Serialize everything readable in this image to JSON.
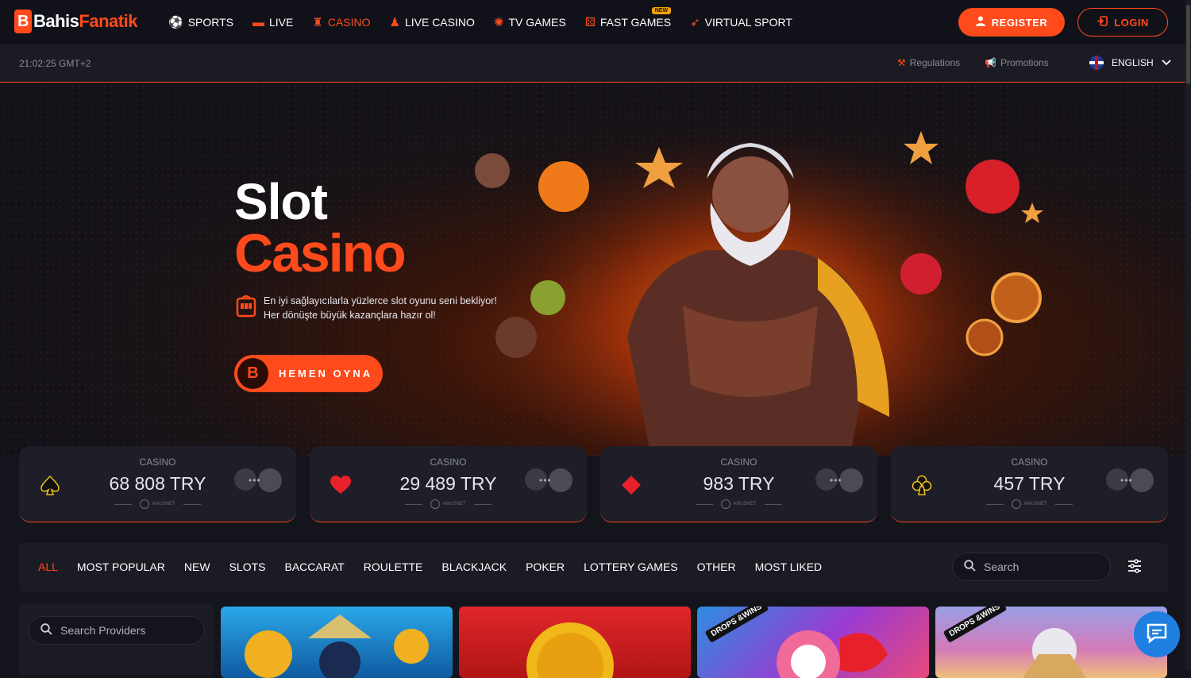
{
  "brand": {
    "name_a": "Bahis",
    "name_b": "Fanatik",
    "mark": "B",
    "accent": "#ff4a1c"
  },
  "nav": [
    {
      "label": "SPORTS",
      "icon": "soccer-ball-icon",
      "glyph": "⚽"
    },
    {
      "label": "LIVE",
      "icon": "live-ticket-icon",
      "glyph": "▬"
    },
    {
      "label": "CASINO",
      "icon": "casino-chips-icon",
      "glyph": "♜"
    },
    {
      "label": "LIVE CASINO",
      "icon": "dealer-icon",
      "glyph": "♟"
    },
    {
      "label": "TV GAMES",
      "icon": "wheel-icon",
      "glyph": "✺"
    },
    {
      "label": "FAST GAMES",
      "icon": "dice-icon",
      "glyph": "⚄",
      "badge": "NEW"
    },
    {
      "label": "VIRTUAL SPORT",
      "icon": "virtual-icon",
      "glyph": "➶"
    }
  ],
  "auth": {
    "register": "REGISTER",
    "login": "LOGIN"
  },
  "subbar": {
    "clock": "21:02:25 GMT+2",
    "regulations": "Regulations",
    "promotions": "Promotions",
    "language": "ENGLISH"
  },
  "hero": {
    "title1": "Slot",
    "title2": "Casino",
    "line1": "En iyi sağlayıcılarla yüzlerce slot oyunu seni bekliyor!",
    "line2": "Her dönüşte büyük kazançlara hazır ol!",
    "cta": "HEMEN OYNA"
  },
  "jackpots": [
    {
      "label": "CASINO",
      "amount": "68 808 TRY",
      "suit": "spade",
      "provider": "AMUSNET"
    },
    {
      "label": "CASINO",
      "amount": "29 489 TRY",
      "suit": "heart",
      "provider": "AMUSNET"
    },
    {
      "label": "CASINO",
      "amount": "983 TRY",
      "suit": "diamond",
      "provider": "AMUSNET"
    },
    {
      "label": "CASINO",
      "amount": "457 TRY",
      "suit": "club",
      "provider": "AMUSNET"
    }
  ],
  "categories": [
    "ALL",
    "MOST POPULAR",
    "NEW",
    "SLOTS",
    "BACCARAT",
    "ROULETTE",
    "BLACKJACK",
    "POKER",
    "LOTTERY GAMES",
    "OTHER",
    "MOST LIKED"
  ],
  "search": {
    "placeholder": "Search"
  },
  "providers": {
    "placeholder": "Search Providers"
  },
  "games": [
    {
      "name": "game-tile-1"
    },
    {
      "name": "game-tile-2"
    },
    {
      "name": "game-tile-3",
      "badge": "DROPS &WINS"
    },
    {
      "name": "game-tile-4",
      "badge": "DROPS &WINS"
    }
  ]
}
